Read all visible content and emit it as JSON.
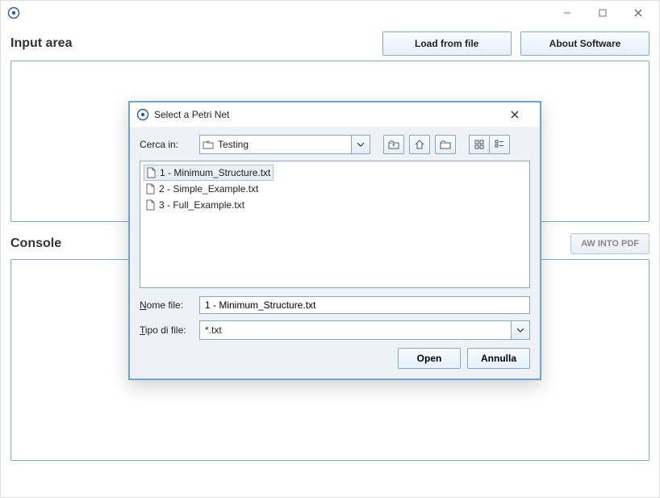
{
  "main": {
    "input_area_title": "Input area",
    "console_title": "Console",
    "buttons": {
      "load_from_file": "Load from file",
      "about_software": "About Software",
      "draw_into_pdf": "AW INTO PDF"
    }
  },
  "dialog": {
    "title": "Select a Petri Net",
    "look_in_label": "Cerca in:",
    "look_in_value": "Testing",
    "file_name_label": "Nome file:",
    "file_name_value": "1 - Minimum_Structure.txt",
    "file_type_label": "Tipo di file:",
    "file_type_value": "*.txt",
    "files": [
      {
        "name": "1 - Minimum_Structure.txt",
        "selected": true
      },
      {
        "name": "2 - Simple_Example.txt",
        "selected": false
      },
      {
        "name": "3 - Full_Example.txt",
        "selected": false
      }
    ],
    "open_label": "Open",
    "cancel_label": "Annulla"
  }
}
